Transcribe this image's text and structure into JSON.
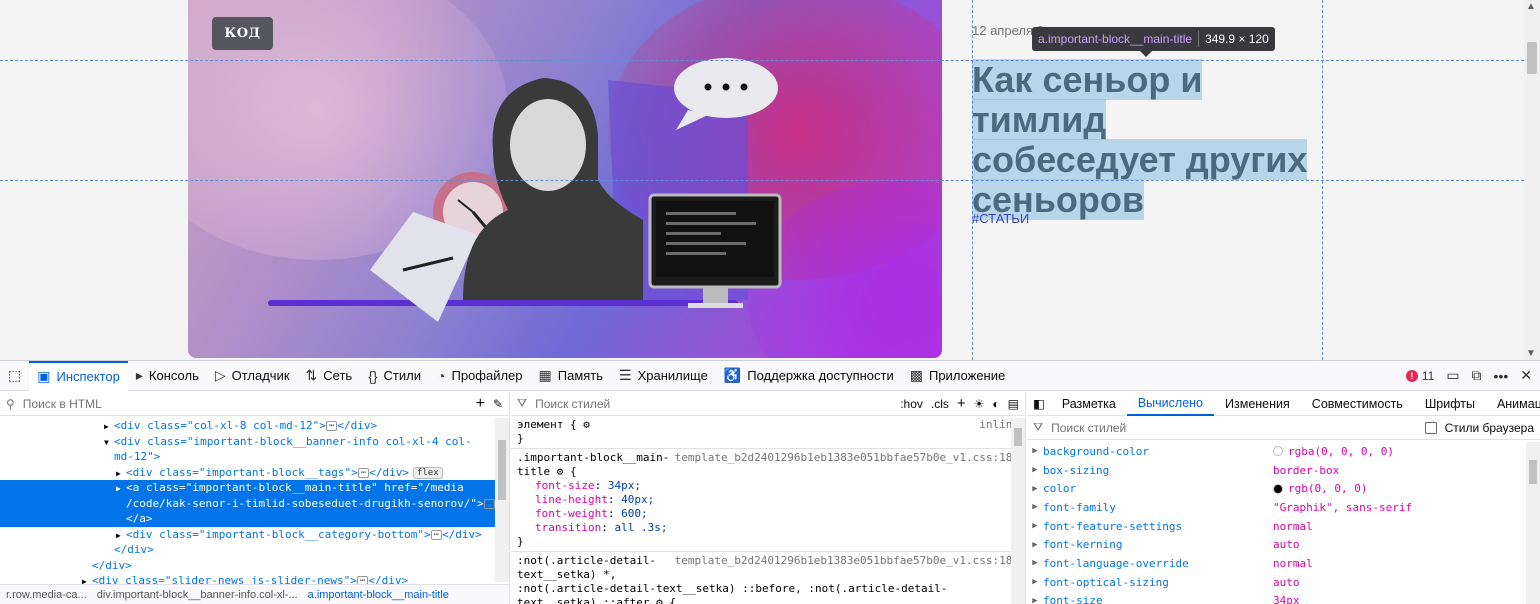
{
  "page": {
    "tag_button": "КОД",
    "date": "12 апреля 2",
    "title_lines": [
      "Как сеньор и тимлид",
      "собеседует других",
      "сеньоров"
    ],
    "category": "#СТАТЬИ",
    "tooltip": {
      "selector": "a.important-block__main-title",
      "size": "349.9 × 120"
    }
  },
  "devtools": {
    "tabs": [
      {
        "label": "Инспектор",
        "icon": "inspector-icon",
        "active": true
      },
      {
        "label": "Консоль",
        "icon": "console-icon"
      },
      {
        "label": "Отладчик",
        "icon": "debugger-icon"
      },
      {
        "label": "Сеть",
        "icon": "network-icon"
      },
      {
        "label": "Стили",
        "icon": "style-editor-icon"
      },
      {
        "label": "Профайлер",
        "icon": "profiler-icon"
      },
      {
        "label": "Память",
        "icon": "memory-icon"
      },
      {
        "label": "Хранилище",
        "icon": "storage-icon"
      },
      {
        "label": "Поддержка доступности",
        "icon": "accessibility-icon"
      },
      {
        "label": "Приложение",
        "icon": "application-icon"
      }
    ],
    "error_count": "11",
    "html_search_placeholder": "Поиск в HTML",
    "styles_search_placeholder": "Поиск стилей",
    "hov": ":hov",
    "cls": ".cls",
    "tree": [
      {
        "indent": 1,
        "open": false,
        "html": "<div class=\"col-xl-8 col-md-12\">",
        "close": "</div>",
        "ellipsis": true
      },
      {
        "indent": 1,
        "open": true,
        "html": "<div class=\"important-block__banner-info col-xl-4 col-",
        "close": ""
      },
      {
        "indent": 1,
        "open": null,
        "html": "md-12\">",
        "close": ""
      },
      {
        "indent": 2,
        "open": false,
        "html": "<div class=\"important-block__tags\">",
        "close": "</div>",
        "ellipsis": true,
        "badge": "flex"
      },
      {
        "indent": 2,
        "open": false,
        "selected": true,
        "html": "<a class=\"important-block__main-title\" href=\"/media",
        "close": ""
      },
      {
        "indent": 2,
        "open": null,
        "selected": true,
        "html": "/code/kak-senor-i-timlid-sobeseduet-drugikh-senorov/\">",
        "close": "",
        "ellipsis": true
      },
      {
        "indent": 2,
        "open": null,
        "selected": true,
        "html": "</a>",
        "close": ""
      },
      {
        "indent": 2,
        "open": false,
        "html": "<div class=\"important-block__category-bottom\">",
        "close": "</div>",
        "ellipsis": true
      },
      {
        "indent": 1,
        "open": null,
        "html": "</div>",
        "close": ""
      },
      {
        "indent": 0,
        "open": null,
        "html": "</div>",
        "close": ""
      },
      {
        "indent": 0,
        "open": false,
        "html": "<div class=\"slider-news js-slider-news\">",
        "close": "</div>",
        "ellipsis": true
      }
    ],
    "breadcrumbs": [
      "r.row.media-ca...",
      "div.important-block__banner-info.col-xl-...",
      "a.important-block__main-title"
    ],
    "rules": {
      "element_line": "элемент {",
      "element_source": "inline",
      "element_close": "}",
      "rule1_sel_a": ".important-block__main-",
      "rule1_sel_b": "title",
      "rule1_source": "template_b2d2401296b1eb1383e051bbfae57b0e_v1.css:183",
      "decls": [
        {
          "prop": "font-size",
          "val": "34px;"
        },
        {
          "prop": "line-height",
          "val": "40px;"
        },
        {
          "prop": "font-weight",
          "val": "600;"
        },
        {
          "prop": "transition",
          "val": "all .3s;"
        }
      ],
      "rule1_close": "}",
      "rule2_sel_a": ":not(.article-detail-",
      "rule2_sel_b": "text__setka) *,",
      "rule2_sel_c": ":not(.article-detail-text__setka) ::before, :not(.article-detail-",
      "rule2_sel_d": "text__setka) ::after",
      "rule2_source": "template_b2d2401296b1eb1383e051bbfae57b0e_v1.css:183"
    },
    "side_tabs": [
      "Разметка",
      "Вычислено",
      "Изменения",
      "Совместимость",
      "Шрифты",
      "Анимаци"
    ],
    "side_active": "Вычислено",
    "computed_search_placeholder": "Поиск стилей",
    "browser_styles_label": "Стили браузера",
    "computed": [
      {
        "name": "background-color",
        "value": "rgba(0, 0, 0, 0)",
        "swatch": "transparent"
      },
      {
        "name": "box-sizing",
        "value": "border-box"
      },
      {
        "name": "color",
        "value": "rgb(0, 0, 0)",
        "swatch": "#000000"
      },
      {
        "name": "font-family",
        "value": "\"Graphik\", sans-serif"
      },
      {
        "name": "font-feature-settings",
        "value": "normal"
      },
      {
        "name": "font-kerning",
        "value": "auto"
      },
      {
        "name": "font-language-override",
        "value": "normal"
      },
      {
        "name": "font-optical-sizing",
        "value": "auto"
      },
      {
        "name": "font-size",
        "value": "34px"
      }
    ]
  }
}
